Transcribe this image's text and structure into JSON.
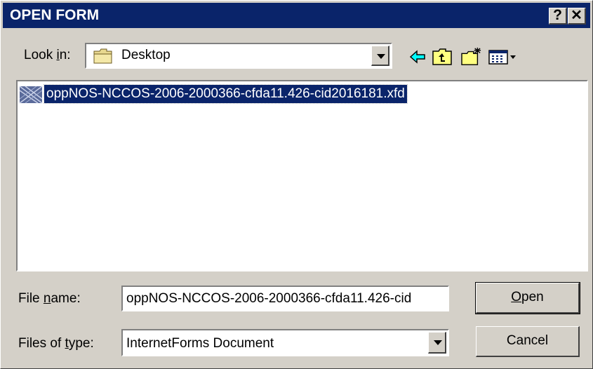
{
  "window": {
    "title": "OPEN FORM",
    "help_label": "?",
    "close_label": "✕"
  },
  "look_in": {
    "label_pre": "Look ",
    "label_key": "i",
    "label_post": "n:",
    "value": "Desktop"
  },
  "toolbar": {
    "icons": [
      "back-arrow-icon",
      "up-folder-icon",
      "new-folder-icon",
      "view-menu-icon"
    ]
  },
  "files": [
    {
      "name": "oppNOS-NCCOS-2006-2000366-cfda11.426-cid2016181.xfd",
      "selected": true
    }
  ],
  "file_name": {
    "label_pre": "File ",
    "label_key": "n",
    "label_post": "ame:",
    "value": "oppNOS-NCCOS-2006-2000366-cfda11.426-cid"
  },
  "files_of_type": {
    "label_pre": "Files of ",
    "label_key": "t",
    "label_post": "ype:",
    "value": "InternetForms Document"
  },
  "buttons": {
    "open_key": "O",
    "open_rest": "pen",
    "cancel": "Cancel"
  },
  "colors": {
    "titlebar": "#0a246a",
    "face": "#d4d0c8",
    "selection": "#0a246a"
  }
}
